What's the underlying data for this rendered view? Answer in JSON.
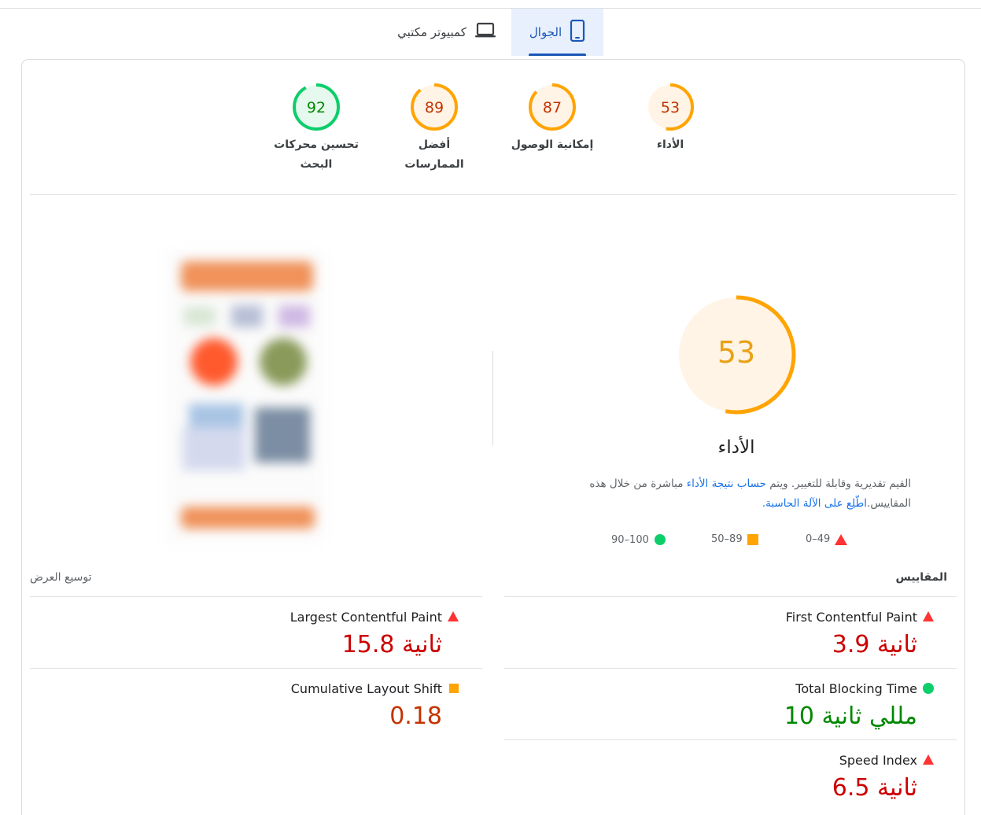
{
  "tabs": {
    "mobile": "الجوال",
    "desktop": "كمبيوتر مكتبي"
  },
  "categories": [
    {
      "id": "performance",
      "label": "الأداء",
      "score": 53,
      "status": "average"
    },
    {
      "id": "accessibility",
      "label": "إمكانية الوصول",
      "score": 87,
      "status": "average"
    },
    {
      "id": "best-practices",
      "label": "أفضل الممارسات",
      "score": 89,
      "status": "average"
    },
    {
      "id": "seo",
      "label": "تحسين محركات البحث",
      "score": 92,
      "status": "pass"
    }
  ],
  "performance": {
    "title": "الأداء",
    "score": 53,
    "desc_before": "القيم تقديرية وقابلة للتغيير. ويتم ",
    "desc_link1": "حساب نتيجة الأداء",
    "desc_middle": " مباشرة من خلال هذه المقاييس.",
    "desc_link2": "اطّلِع على الآلة الحاسبة."
  },
  "legend": {
    "fail": "0–49",
    "average": "50–89",
    "pass": "90–100"
  },
  "metrics_section": {
    "title": "المقاييس",
    "expand": "توسيع العرض"
  },
  "metrics": {
    "fcp": {
      "name": "First Contentful Paint",
      "value": "3.9 ثانية",
      "status": "fail"
    },
    "lcp": {
      "name": "Largest Contentful Paint",
      "value": "15.8 ثانية",
      "status": "fail"
    },
    "tbt": {
      "name": "Total Blocking Time",
      "value": "10 مللي ثانية",
      "status": "pass"
    },
    "cls": {
      "name": "Cumulative Layout Shift",
      "value": "0.18",
      "status": "average"
    },
    "si": {
      "name": "Speed Index",
      "value": "6.5 ثانية",
      "status": "fail"
    }
  },
  "colors": {
    "fail": "#cc0000",
    "average": "#c33300",
    "pass": "#008800",
    "ring_average": "#ffa400",
    "ring_pass": "#0cce6b",
    "accent": "#1a56b8"
  },
  "icons": {
    "mobile": "smartphone-icon",
    "desktop": "laptop-icon"
  }
}
